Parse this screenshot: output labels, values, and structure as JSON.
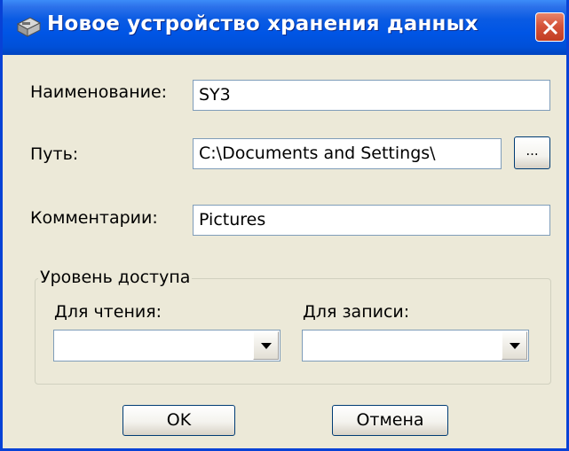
{
  "window": {
    "title": "Новое устройство хранения данных",
    "icon": "storage-device-icon"
  },
  "form": {
    "name_label": "Наименование:",
    "name_value": "SY3",
    "path_label": "Путь:",
    "path_value": "C:\\Documents and Settings\\",
    "browse_label": "...",
    "comment_label": "Комментарии:",
    "comment_value": "Pictures"
  },
  "access": {
    "group_label": "Уровень доступа",
    "read_label": "Для чтения:",
    "read_value": "",
    "write_label": "Для записи:",
    "write_value": ""
  },
  "buttons": {
    "ok": "OK",
    "cancel": "Отмена"
  },
  "colors": {
    "titlebar": "#0055e5",
    "dialog_bg": "#ece9d8",
    "close_button": "#c94f35"
  }
}
